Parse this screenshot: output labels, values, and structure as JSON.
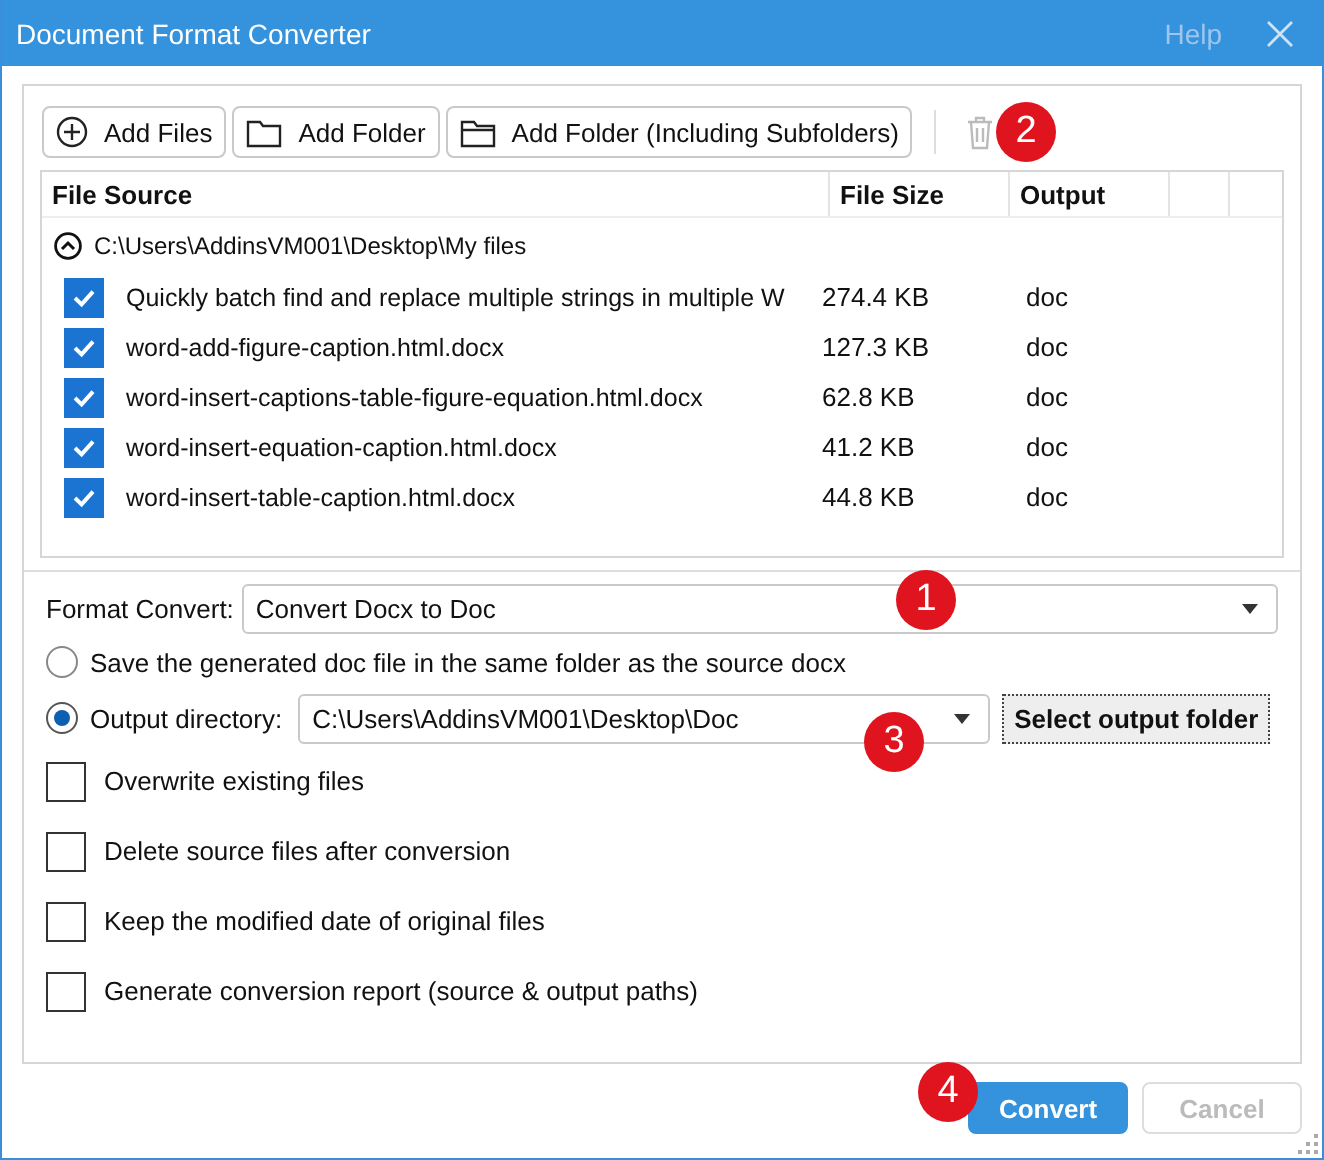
{
  "window": {
    "title": "Document Format Converter",
    "help": "Help"
  },
  "toolbar": {
    "buttons": [
      {
        "kind": "add",
        "label": "Add Files"
      },
      {
        "kind": "folder",
        "label": "Add Folder"
      },
      {
        "kind": "folder-open",
        "label": "Add Folder (Including Subfolders)"
      }
    ],
    "delete": {
      "disabled": true
    }
  },
  "table": {
    "columns": [
      "File Source",
      "File Size",
      "Output"
    ],
    "group": {
      "path": "C:\\Users\\AddinsVM001\\Desktop\\My files",
      "expanded": true,
      "rows": [
        {
          "name": "Quickly batch find and replace multiple strings in multiple W",
          "size": "274.4 KB",
          "output": "doc",
          "checked": true
        },
        {
          "name": "word-add-figure-caption.html.docx",
          "size": "127.3 KB",
          "output": "doc",
          "checked": true
        },
        {
          "name": "word-insert-captions-table-figure-equation.html.docx",
          "size": "62.8 KB",
          "output": "doc",
          "checked": true
        },
        {
          "name": "word-insert-equation-caption.html.docx",
          "size": "41.2 KB",
          "output": "doc",
          "checked": true
        },
        {
          "name": "word-insert-table-caption.html.docx",
          "size": "44.8 KB",
          "output": "doc",
          "checked": true
        }
      ]
    }
  },
  "format_convert": {
    "label": "Format Convert:",
    "value": "Convert Docx to Doc"
  },
  "output_options": [
    {
      "kind": "plain",
      "label": "Save the generated doc file in the same folder as the source docx",
      "selected": false
    },
    {
      "kind": "directory",
      "label": "Output directory:",
      "selected": true,
      "value": "C:\\Users\\AddinsVM001\\Desktop\\Doc",
      "button": "Select output folder"
    }
  ],
  "checkboxes": [
    {
      "label": "Overwrite existing files",
      "checked": false
    },
    {
      "label": "Delete source files after conversion",
      "checked": false
    },
    {
      "label": "Keep the modified date of original files",
      "checked": false
    },
    {
      "label": "Generate conversion report (source & output paths)",
      "checked": false
    }
  ],
  "buttons": [
    {
      "kind": "primary",
      "label": "Convert",
      "disabled": false
    },
    {
      "kind": "secondary",
      "label": "Cancel",
      "disabled": true
    }
  ],
  "callouts": [
    {
      "label": "1"
    },
    {
      "label": "2"
    },
    {
      "label": "3"
    },
    {
      "label": "4"
    }
  ]
}
